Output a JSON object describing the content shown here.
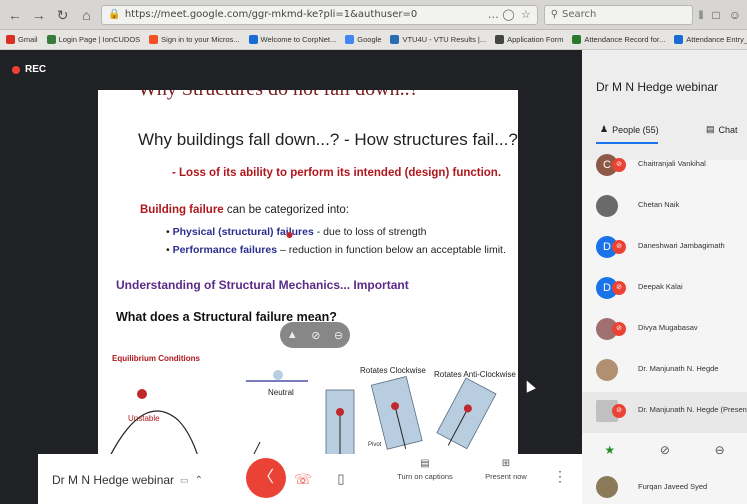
{
  "browser": {
    "url": "https://meet.google.com/ggr-mkmd-ke?pli=1&authuser=0",
    "search_placeholder": "Search",
    "bookmarks": [
      {
        "label": "Gmail",
        "color": "#d93025"
      },
      {
        "label": "Login Page | IonCUDOS",
        "color": "#3a7a3a"
      },
      {
        "label": "Sign in to your Micros...",
        "color": "#f25022"
      },
      {
        "label": "Welcome to CorpNet...",
        "color": "#1a6ad8"
      },
      {
        "label": "Google",
        "color": "#4285f4"
      },
      {
        "label": "VTU4U - VTU Results |...",
        "color": "#2b6cb0"
      },
      {
        "label": "Application Form",
        "color": "#444"
      },
      {
        "label": "Attendance Record for...",
        "color": "#2c7a2c"
      },
      {
        "label": "Attendance Entry_ECE",
        "color": "#1a6ad8"
      }
    ]
  },
  "stage": {
    "rec_label": "REC",
    "slide": {
      "title": "Why Structures do not fall down..?",
      "question": "Why buildings fall down...?   - How structures fail...?",
      "loss": "- Loss of its ability to perform its intended (design) function.",
      "bf_bold": "Building failure",
      "bf_rest": " can be categorized into:",
      "b1_bold": "Physical (structural) failures",
      "b1_rest": " - due to loss of strength",
      "b2_bold": "Performance failures",
      "b2_rest": " – reduction in function below an acceptable limit.",
      "understanding": "Understanding of Structural Mechanics... Important",
      "q2": "What does a Structural failure mean?",
      "eq": "Equilibrium Conditions",
      "neutral": "Neutral",
      "unstable": "Unstable",
      "cw": "Rotates Clockwise",
      "acw": "Rotates Anti-Clockwise",
      "pivot": "Pivot"
    }
  },
  "bottombar": {
    "meeting_title": "Dr M N Hedge webinar",
    "captions_label": "Turn on captions",
    "present_label": "Present now"
  },
  "panel": {
    "title": "Dr M N Hedge webinar",
    "people_tab": "People (55)",
    "chat_tab": "Chat",
    "participants": [
      {
        "name": "Chaitranjali Vankihal",
        "initial": "C",
        "color": "#8d5a47",
        "muted": true
      },
      {
        "name": "Chetan Naik",
        "initial": "",
        "color": "#6a6a6a",
        "muted": false
      },
      {
        "name": "Daneshwari Jambagimath",
        "initial": "D",
        "color": "#1a73e8",
        "muted": true
      },
      {
        "name": "Deepak Kalai",
        "initial": "D",
        "color": "#1a73e8",
        "muted": true
      },
      {
        "name": "Divya Mugabasav",
        "initial": "",
        "color": "#a07070",
        "muted": true
      },
      {
        "name": "Dr. Manjunath N. Hegde",
        "initial": "",
        "color": "#b09070",
        "muted": false
      },
      {
        "name": "Dr. Manjunath N. Hegde (Presentation)",
        "initial": "",
        "color": "#c0c0c0",
        "muted": true
      }
    ],
    "last_participant": "Furqan Javeed Syed"
  }
}
